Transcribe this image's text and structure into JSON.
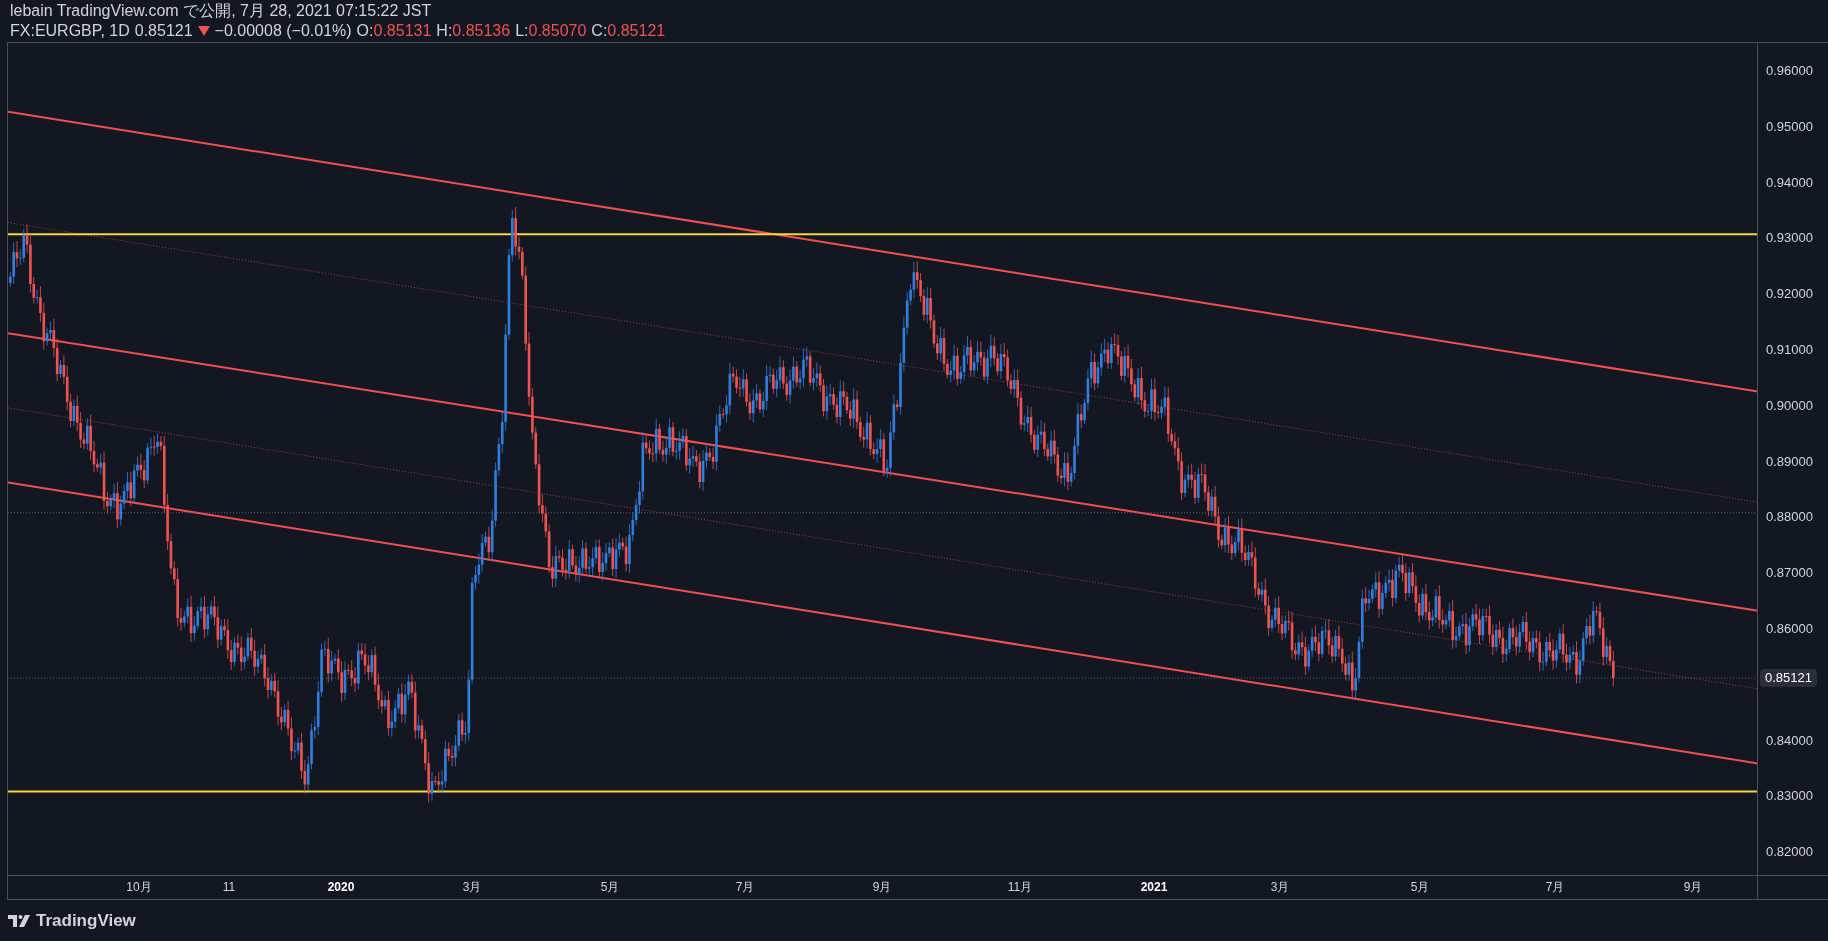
{
  "header": {
    "title": "lebain TradingView.com で公開, 7月 28, 2021 07:15:22 JST",
    "quote": {
      "symbol": "FX:EURGBP, 1D",
      "price": "0.85121",
      "falling": true,
      "change": "−0.00008 (−0.01%)",
      "ohlc": [
        {
          "label": "O:",
          "value": "0.85131"
        },
        {
          "label": "H:",
          "value": "0.85136"
        },
        {
          "label": "L:",
          "value": "0.85070"
        },
        {
          "label": "C:",
          "value": "0.85121"
        }
      ]
    }
  },
  "price_axis": {
    "labels": [
      "0.96000",
      "0.95000",
      "0.94000",
      "0.93000",
      "0.92000",
      "0.91000",
      "0.90000",
      "0.89000",
      "0.88000",
      "0.87000",
      "0.86000",
      "0.84000",
      "0.83000",
      "0.82000"
    ],
    "current_price": "0.85121"
  },
  "time_axis": {
    "labels": [
      {
        "text": "10月",
        "kind": "month"
      },
      {
        "text": "11",
        "kind": "month"
      },
      {
        "text": "2020",
        "kind": "year"
      },
      {
        "text": "3月",
        "kind": "month"
      },
      {
        "text": "5月",
        "kind": "month"
      },
      {
        "text": "7月",
        "kind": "month"
      },
      {
        "text": "9月",
        "kind": "month"
      },
      {
        "text": "11月",
        "kind": "month"
      },
      {
        "text": "2021",
        "kind": "year"
      },
      {
        "text": "3月",
        "kind": "month"
      },
      {
        "text": "5月",
        "kind": "month"
      },
      {
        "text": "7月",
        "kind": "month"
      },
      {
        "text": "9月",
        "kind": "month"
      }
    ]
  },
  "footer": {
    "brand": "TradingView"
  }
}
